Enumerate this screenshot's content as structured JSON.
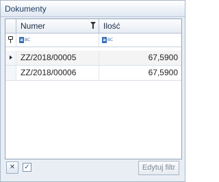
{
  "panel": {
    "title": "Dokumenty"
  },
  "columns": [
    {
      "label": "Numer",
      "has_filter_icon": true
    },
    {
      "label": "Ilość"
    }
  ],
  "filter_row": {
    "numer_icon": "abc-text-filter-icon",
    "ilosc_icon": "abc-text-filter-icon",
    "abc_letter": "a",
    "abc_text": "BC"
  },
  "rows": [
    {
      "numer": "ZZ/2018/00005",
      "ilosc": "67,5900",
      "selected": true
    },
    {
      "numer": "ZZ/2018/00006",
      "ilosc": "67,5900",
      "selected": false
    }
  ],
  "footer": {
    "clear_icon": "✕",
    "checkbox_glyph": "✓",
    "edit_filter_label": "Edytuj filtr"
  }
}
